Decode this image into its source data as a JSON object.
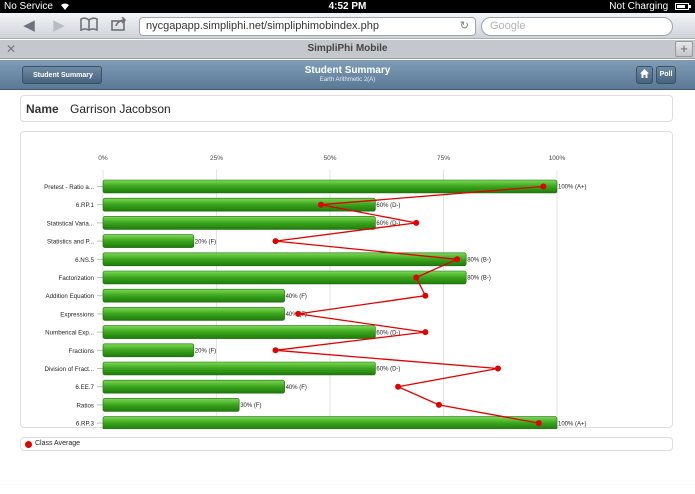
{
  "status_bar": {
    "carrier": "No Service",
    "time": "4:52 PM",
    "battery": "Not Charging"
  },
  "browser": {
    "url": "nycgapapp.simpliphi.net/simpliphimobindex.php",
    "search_placeholder": "Google",
    "tab_title": "SimpliPhi Mobile"
  },
  "header": {
    "back_label": "Student Summary",
    "title": "Student Summary",
    "subtitle": "Earth Arithmetic 2(A)",
    "poll_label": "Poll"
  },
  "student": {
    "name_label": "Name",
    "name": "Garrison Jacobson"
  },
  "legend": {
    "label": "Class Average",
    "color": "#e00000"
  },
  "chart_data": {
    "type": "bar",
    "orientation": "horizontal",
    "x_ticks": [
      "0%",
      "25%",
      "50%",
      "75%",
      "100%"
    ],
    "xlim": [
      0,
      100
    ],
    "categories": [
      "Pretest - Ratio a...",
      "6.RP.1",
      "Statistical Varia...",
      "Statistics and P...",
      "6.NS.5",
      "Factorization",
      "Addition Equation",
      "Expressions",
      "Numberical Exp...",
      "Fractions",
      "Division of Fract...",
      "6.EE.7",
      "Ratios",
      "6.RP.3"
    ],
    "series": [
      {
        "values": [
          100,
          60,
          60,
          20,
          80,
          80,
          40,
          40,
          60,
          20,
          60,
          40,
          30,
          100
        ],
        "labels": [
          "100% (A+)",
          "60% (D-)",
          "60% (D-)",
          "20% (F)",
          "80% (B-)",
          "80% (B-)",
          "40% (F)",
          "40% (F)",
          "60% (D-)",
          "20% (F)",
          "60% (D-)",
          "40% (F)",
          "30% (F)",
          "100% (A+)"
        ],
        "color": "#3aa51c"
      },
      {
        "name": "Class Average",
        "values": [
          97,
          48,
          69,
          38,
          78,
          69,
          71,
          43,
          71,
          38,
          87,
          65,
          74,
          96
        ],
        "color": "#e00000"
      }
    ],
    "grid": true,
    "legend_position": "bottom-left"
  }
}
